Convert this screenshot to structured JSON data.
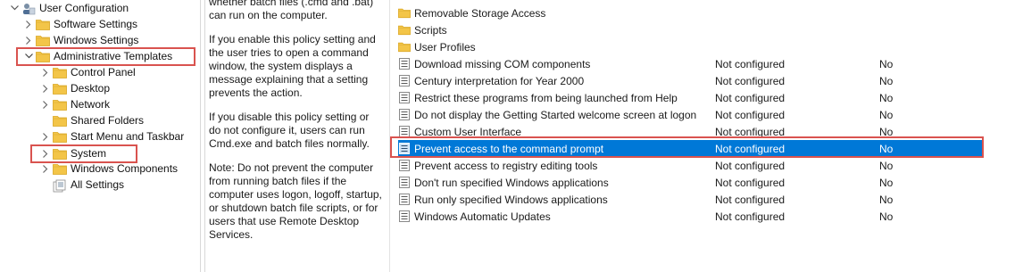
{
  "tree": {
    "root": "User Configuration",
    "items": [
      {
        "label": "Software Settings"
      },
      {
        "label": "Windows Settings"
      },
      {
        "label": "Administrative Templates"
      },
      {
        "label": "Control Panel"
      },
      {
        "label": "Desktop"
      },
      {
        "label": "Network"
      },
      {
        "label": "Shared Folders"
      },
      {
        "label": "Start Menu and Taskbar"
      },
      {
        "label": "System"
      },
      {
        "label": "Windows Components"
      },
      {
        "label": "All Settings"
      }
    ]
  },
  "description": {
    "p0": "whether batch files (.cmd and .bat) can run on the computer.",
    "p1": "If you enable this policy setting and the user tries to open a command window, the system displays a message explaining that a setting prevents the action.",
    "p2": "If you disable this policy setting or do not configure it, users can run Cmd.exe and batch files normally.",
    "p3": "Note: Do not prevent the computer from running batch files if the computer uses logon, logoff, startup, or shutdown batch file scripts, or for users that use Remote Desktop Services."
  },
  "list": {
    "folders": [
      {
        "name": "Removable Storage Access"
      },
      {
        "name": "Scripts"
      },
      {
        "name": "User Profiles"
      }
    ],
    "policies": [
      {
        "name": "Download missing COM components",
        "state": "Not configured",
        "comment": "No"
      },
      {
        "name": "Century interpretation for Year 2000",
        "state": "Not configured",
        "comment": "No"
      },
      {
        "name": "Restrict these programs from being launched from Help",
        "state": "Not configured",
        "comment": "No"
      },
      {
        "name": "Do not display the Getting Started welcome screen at logon",
        "state": "Not configured",
        "comment": "No"
      },
      {
        "name": "Custom User Interface",
        "state": "Not configured",
        "comment": "No"
      },
      {
        "name": "Prevent access to the command prompt",
        "state": "Not configured",
        "comment": "No"
      },
      {
        "name": "Prevent access to registry editing tools",
        "state": "Not configured",
        "comment": "No"
      },
      {
        "name": "Don't run specified Windows applications",
        "state": "Not configured",
        "comment": "No"
      },
      {
        "name": "Run only specified Windows applications",
        "state": "Not configured",
        "comment": "No"
      },
      {
        "name": "Windows Automatic Updates",
        "state": "Not configured",
        "comment": "No"
      }
    ]
  },
  "colors": {
    "selection": "#0078d7",
    "highlight_box": "#d9534f",
    "folder": "#f5c542"
  }
}
